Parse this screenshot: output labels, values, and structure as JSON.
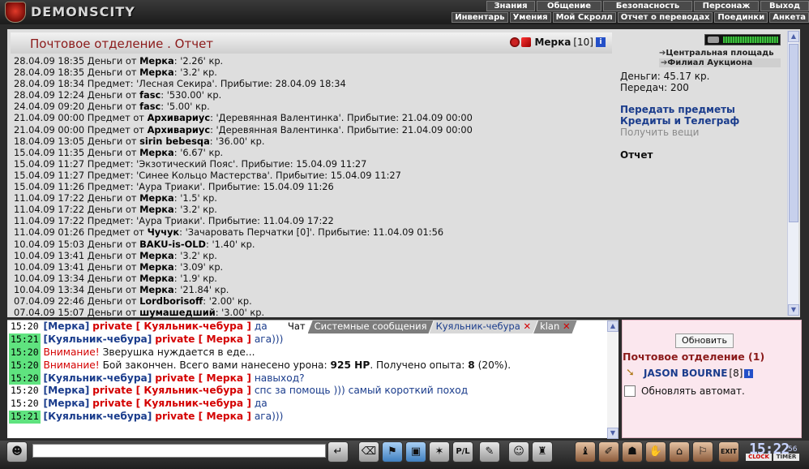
{
  "app": {
    "logo_text": "DEMONSCITY"
  },
  "menu_top": [
    "Знания",
    "Общение",
    "Безопасность",
    "Персонаж",
    "Выход"
  ],
  "menu_sub": [
    "Инвентарь",
    "Умения",
    "Мой Скролл",
    "Отчет о переводах",
    "Поединки",
    "Анкета"
  ],
  "mail": {
    "title": "Почтовое отделение .   Отчет",
    "user_name": "Мерка",
    "user_level": "[10]"
  },
  "log": [
    [
      "28.04.09 18:35 Деньги от ",
      "Мерка",
      ": '2.26' кр."
    ],
    [
      "28.04.09 18:35 Деньги от ",
      "Мерка",
      ": '3.2' кр."
    ],
    [
      "28.04.09 18:34 Предмет: 'Лесная Секира'. Прибытие: 28.04.09 18:34",
      "",
      ""
    ],
    [
      "28.04.09 12:24 Деньги от ",
      "fasc",
      ": '530.00' кр."
    ],
    [
      "24.04.09 09:20 Деньги от ",
      "fasc",
      ": '5.00' кр."
    ],
    [
      "21.04.09 00:00 Предмет от ",
      "Архивариус",
      ": 'Деревянная Валентинка'. Прибытие: 21.04.09 00:00"
    ],
    [
      "21.04.09 00:00 Предмет от ",
      "Архивариус",
      ": 'Деревянная Валентинка'. Прибытие: 21.04.09 00:00"
    ],
    [
      "18.04.09 13:05 Деньги от ",
      "sirin bebesqa",
      ": '36.00' кр."
    ],
    [
      "15.04.09 11:35 Деньги от ",
      "Мерка",
      ": '6.67' кр."
    ],
    [
      "15.04.09 11:27 Предмет: 'Экзотический Пояс'. Прибытие: 15.04.09 11:27",
      "",
      ""
    ],
    [
      "15.04.09 11:27 Предмет: 'Синее Кольцо Мастерства'. Прибытие: 15.04.09 11:27",
      "",
      ""
    ],
    [
      "15.04.09 11:26 Предмет: 'Аура Триаки'. Прибытие: 15.04.09 11:26",
      "",
      ""
    ],
    [
      "11.04.09 17:22 Деньги от ",
      "Мерка",
      ": '1.5' кр."
    ],
    [
      "11.04.09 17:22 Деньги от ",
      "Мерка",
      ": '3.2' кр."
    ],
    [
      "11.04.09 17:22 Предмет: 'Аура Триаки'. Прибытие: 11.04.09 17:22",
      "",
      ""
    ],
    [
      "11.04.09 01:26 Предмет от ",
      "Чучук",
      ": 'Зачаровать Перчатки [0]'. Прибытие: 11.04.09 01:56"
    ],
    [
      "10.04.09 15:03 Деньги от ",
      "BAKU-is-OLD",
      ": '1.40' кр."
    ],
    [
      "10.04.09 13:41 Деньги от ",
      "Мерка",
      ": '3.2' кр."
    ],
    [
      "10.04.09 13:41 Деньги от ",
      "Мерка",
      ": '3.09' кр."
    ],
    [
      "10.04.09 13:34 Деньги от ",
      "Мерка",
      ": '1.9' кр."
    ],
    [
      "10.04.09 13:34 Деньги от ",
      "Мерка",
      ": '21.84' кр."
    ],
    [
      "07.04.09 22:46 Деньги от ",
      "Lordborisoff",
      ": '2.00' кр."
    ],
    [
      "07.04.09 15:07 Деньги от ",
      "шумашедший",
      ": '3.00' кр."
    ]
  ],
  "side": {
    "loc1": "Центральная площадь",
    "loc2": "Филиал Аукциона",
    "money": "Деньги: 45.17 кр.",
    "transfers": "Передач: 200",
    "link_items": "Передать предметы",
    "link_credits": "Кредиты и Телеграф",
    "link_get": "Получить вещи",
    "report": "Отчет"
  },
  "tabs": [
    {
      "label": "Чат",
      "bg": "#ffffff",
      "color": "#000000",
      "close": ""
    },
    {
      "label": "Системные сообщения",
      "bg": "#7d7d7d",
      "color": "#ffffff",
      "close": ""
    },
    {
      "label": "Куяльник-чебура",
      "bg": "#d8d8d8",
      "color": "#1a3c8c",
      "close": "✕"
    },
    {
      "label": "klan",
      "bg": "#8a8a8a",
      "color": "#ffffff",
      "close": "✕"
    }
  ],
  "chat": [
    {
      "time": "15:20",
      "green": false,
      "from": "Мерка",
      "to": "Куяльник-чебура",
      "msg": "да",
      "kind": "private"
    },
    {
      "time": "15:21",
      "green": true,
      "from": "Куяльник-чебура",
      "to": "Мерка",
      "msg": "ага)))",
      "kind": "private"
    },
    {
      "time": "15:20",
      "green": true,
      "warn": "Внимание!",
      "msg": "Зверушка нуждается в еде...",
      "kind": "system"
    },
    {
      "time": "15:20",
      "green": true,
      "warn": "Внимание!",
      "msg_pre": "Бой закончен. Всего вами нанесено урона: ",
      "msg_b1": "925 HP",
      "msg_mid": ". Получено опыта: ",
      "msg_b2": "8",
      "msg_post": " (20%).",
      "kind": "system2"
    },
    {
      "time": "15:20",
      "green": true,
      "from": "Куяльник-чебура",
      "to": "Мерка",
      "msg": "навыход?",
      "kind": "private"
    },
    {
      "time": "15:20",
      "green": false,
      "from": "Мерка",
      "to": "Куяльник-чебура",
      "msg": "спс за помощь ))) самый короткий поход",
      "kind": "private"
    },
    {
      "time": "15:20",
      "green": false,
      "from": "Мерка",
      "to": "Куяльник-чебура",
      "msg": "да",
      "kind": "private"
    },
    {
      "time": "15:21",
      "green": true,
      "from": "Куяльник-чебура",
      "to": "Мерка",
      "msg": "ага)))",
      "kind": "private"
    }
  ],
  "chat_labels": {
    "private": "private"
  },
  "mail_panel": {
    "refresh": "Обновить",
    "title": "Почтовое отделение (1)",
    "user": "JASON BOURNE",
    "level": "[8]",
    "auto": "Обновлять автомат."
  },
  "toolbar_icons": [
    "speaker-icon",
    "enter-icon",
    "eraser-icon",
    "filter-icon",
    "save-icon",
    "fighter-icon",
    "pl-icon",
    "pen-icon",
    "smiley-icon",
    "trophy-icon",
    "bag-icon",
    "scroll-icon",
    "helmet-icon",
    "hands-icon",
    "lock-icon",
    "flag-icon",
    "exit-icon"
  ],
  "clock": {
    "time": "15:22",
    "sec": "56",
    "a": "CLOCK",
    "b": "TIMER"
  },
  "colors": {
    "title": "#8b1a1a",
    "link": "#1a3c8c",
    "private": "#d40000",
    "time_bg": "#5fe37f"
  }
}
